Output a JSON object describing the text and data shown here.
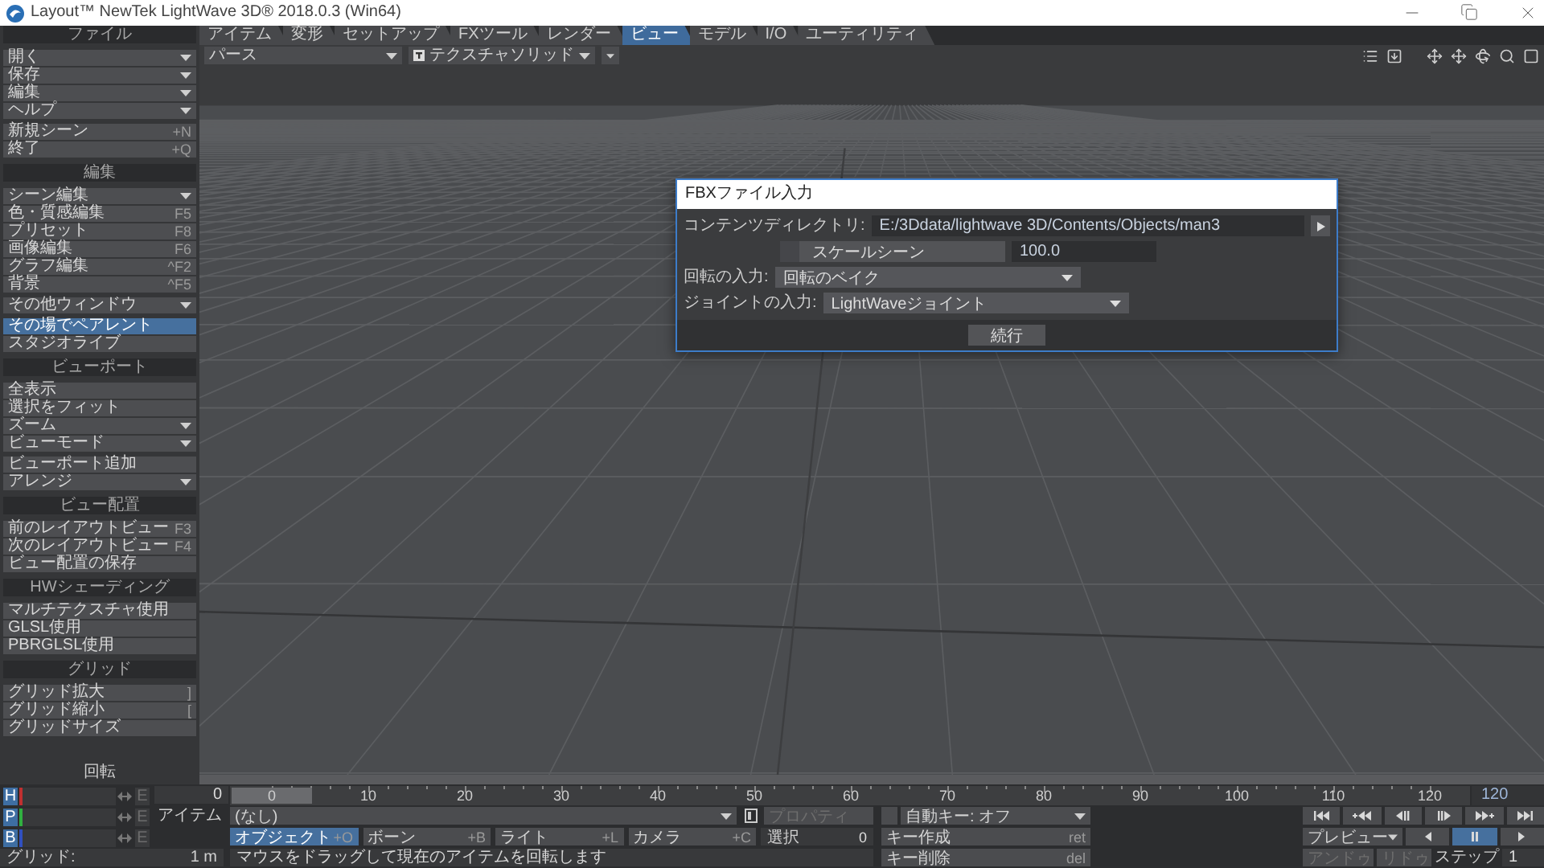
{
  "window": {
    "title": "Layout™ NewTek LightWave 3D® 2018.0.3 (Win64)"
  },
  "sidebar": {
    "sections": [
      {
        "header": "ファイル",
        "groups": [
          [
            {
              "label": "開く",
              "kind": "menu",
              "selected": false
            },
            {
              "label": "保存",
              "kind": "menu",
              "selected": false
            },
            {
              "label": "編集",
              "kind": "menu",
              "selected": false
            },
            {
              "label": "ヘルプ",
              "kind": "menu",
              "selected": false
            }
          ],
          [
            {
              "label": "新規シーン",
              "kind": "command",
              "shortcut": "+N",
              "selected": false
            },
            {
              "label": "終了",
              "kind": "command",
              "shortcut": "+Q",
              "selected": false
            }
          ]
        ]
      },
      {
        "header": "編集",
        "groups": [
          [
            {
              "label": "シーン編集",
              "kind": "menu",
              "selected": false
            },
            {
              "label": "色・質感編集",
              "kind": "command",
              "shortcut": "F5",
              "selected": false
            },
            {
              "label": "プリセット",
              "kind": "command",
              "shortcut": "F8",
              "selected": false
            },
            {
              "label": "画像編集",
              "kind": "command",
              "shortcut": "F6",
              "selected": false
            },
            {
              "label": "グラフ編集",
              "kind": "command",
              "shortcut": "^F2",
              "selected": false
            },
            {
              "label": "背景",
              "kind": "command",
              "shortcut": "^F5",
              "selected": false
            }
          ],
          [
            {
              "label": "その他ウィンドウ",
              "kind": "menu",
              "selected": false
            }
          ],
          [
            {
              "label": "その場でペアレント",
              "kind": "command",
              "selected": true
            },
            {
              "label": "スタジオライブ",
              "kind": "command",
              "selected": false
            }
          ]
        ]
      },
      {
        "header": "ビューポート",
        "groups": [
          [
            {
              "label": "全表示",
              "kind": "command",
              "selected": false
            },
            {
              "label": "選択をフィット",
              "kind": "command",
              "selected": false
            },
            {
              "label": "ズーム",
              "kind": "menu",
              "selected": false
            },
            {
              "label": "ビューモード",
              "kind": "menu",
              "selected": false
            }
          ],
          [
            {
              "label": "ビューポート追加",
              "kind": "command",
              "selected": false
            },
            {
              "label": "アレンジ",
              "kind": "menu",
              "selected": false
            }
          ]
        ]
      },
      {
        "header": "ビュー配置",
        "groups": [
          [
            {
              "label": "前のレイアウトビュー",
              "kind": "command",
              "shortcut": "F3",
              "selected": false
            },
            {
              "label": "次のレイアウトビュー",
              "kind": "command",
              "shortcut": "F4",
              "selected": false
            },
            {
              "label": "ビュー配置の保存",
              "kind": "command",
              "selected": false
            }
          ]
        ]
      },
      {
        "header": "HWシェーディング",
        "groups": [
          [
            {
              "label": "マルチテクスチャ使用",
              "kind": "command",
              "selected": false
            },
            {
              "label": "GLSL使用",
              "kind": "command",
              "selected": false
            },
            {
              "label": "PBRGLSL使用",
              "kind": "command",
              "selected": false
            }
          ]
        ]
      },
      {
        "header": "グリッド",
        "groups": [
          [
            {
              "label": "グリッド拡大",
              "kind": "command",
              "shortcut": "]",
              "selected": false
            },
            {
              "label": "グリッド縮小",
              "kind": "command",
              "shortcut": "[",
              "selected": false
            },
            {
              "label": "グリッドサイズ",
              "kind": "command",
              "selected": false
            }
          ]
        ]
      }
    ],
    "footer": "回転"
  },
  "tabs": [
    {
      "label": "アイテム",
      "selected": false
    },
    {
      "label": "変形",
      "selected": false
    },
    {
      "label": "セットアップ",
      "selected": false
    },
    {
      "label": "FXツール",
      "selected": false
    },
    {
      "label": "レンダー",
      "selected": false
    },
    {
      "label": "ビュー",
      "selected": true
    },
    {
      "label": "モデル",
      "selected": false
    },
    {
      "label": "I/O",
      "selected": false
    },
    {
      "label": "ユーティリティ",
      "selected": false
    }
  ],
  "toolbar": {
    "view_mode": "パース",
    "shading": "テクスチャソリッド"
  },
  "dialog": {
    "title": "FBXファイル入力",
    "content_dir": {
      "label": "コンテンツディレクトリ:",
      "value": "E:/3Ddata/lightwave 3D/Contents/Objects/man3"
    },
    "scale": {
      "label": "スケールシーン",
      "checked": false,
      "value": "100.0"
    },
    "selects": [
      {
        "label": "回転の入力:",
        "value": "回転のベイク"
      },
      {
        "label": "ジョイントの入力:",
        "value": "LightWaveジョイント"
      }
    ],
    "ok": "続行"
  },
  "bottom": {
    "channels": [
      {
        "label": "H",
        "color": "#c03030",
        "key": "E"
      },
      {
        "label": "P",
        "color": "#30b040",
        "key": "E"
      },
      {
        "label": "B",
        "color": "#3050c0",
        "key": "E"
      }
    ],
    "grid": {
      "label": "グリッド:",
      "value": "1 m"
    },
    "frame": "0",
    "timeline": {
      "ticks": [
        "0",
        "10",
        "20",
        "30",
        "40",
        "50",
        "60",
        "70",
        "80",
        "90",
        "100",
        "110",
        "120"
      ],
      "level": 0,
      "end": "120"
    },
    "item": {
      "label": "アイテム",
      "value": "(なし)"
    },
    "properties": {
      "label": "プロパティ",
      "disabled": true
    },
    "auto_key": "自動キー: オフ",
    "item_types": [
      {
        "label": "オブジェクト",
        "shortcut": "+O",
        "selected": true
      },
      {
        "label": "ボーン",
        "shortcut": "+B",
        "selected": false
      },
      {
        "label": "ライト",
        "shortcut": "+L",
        "selected": false
      },
      {
        "label": "カメラ",
        "shortcut": "+C",
        "selected": false
      }
    ],
    "selection": {
      "label": "選択",
      "value": "0"
    },
    "create_key": {
      "label": "キー作成",
      "shortcut": "ret"
    },
    "delete_key": {
      "label": "キー削除",
      "shortcut": "del"
    },
    "status": "マウスをドラッグして現在のアイテムを回転します",
    "playback": [
      {
        "kind": "reverse",
        "selected": false
      },
      {
        "kind": "pause",
        "selected": true
      },
      {
        "kind": "play",
        "selected": false
      }
    ],
    "preview": "プレビュー",
    "undo": {
      "label": "アンドゥ",
      "disabled": true
    },
    "redo": {
      "label": "リドゥ",
      "disabled": true
    },
    "step": {
      "label": "ステップ",
      "value": "1"
    }
  }
}
